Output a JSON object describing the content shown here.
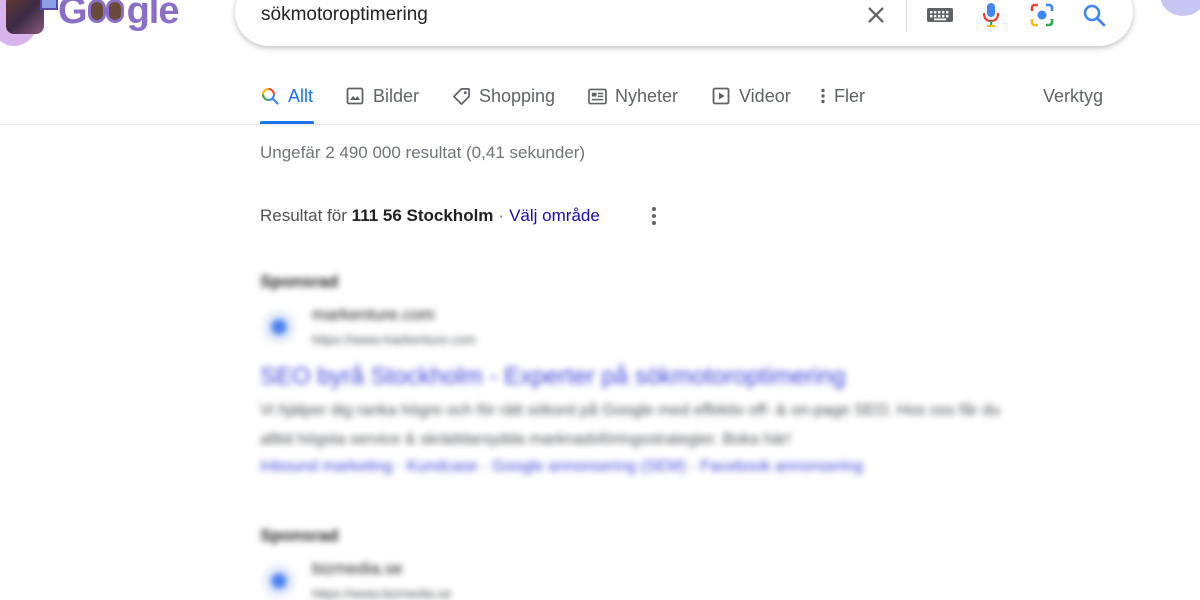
{
  "header": {
    "logo_text_g": "G",
    "logo_text_end": "gle",
    "query": "sökmotoroptimering"
  },
  "tabs": [
    {
      "label": "Allt",
      "icon": "search-icon",
      "active": true
    },
    {
      "label": "Bilder",
      "icon": "image-icon"
    },
    {
      "label": "Shopping",
      "icon": "tag-icon"
    },
    {
      "label": "Nyheter",
      "icon": "news-icon"
    },
    {
      "label": "Videor",
      "icon": "play-icon"
    },
    {
      "label": "Fler",
      "icon": "more-vert-icon"
    }
  ],
  "tools_label": "Verktyg",
  "stats": "Ungefär 2 490 000 resultat (0,41 sekunder)",
  "location": {
    "prefix": "Resultat för",
    "place": "111 56 Stockholm",
    "separator": "·",
    "change_link": "Välj område"
  },
  "ads": [
    {
      "sponsored": "Sponsrad",
      "site": "markenture.com",
      "url": "https://www.markenture.com",
      "title": "SEO byrå Stockholm - Experter på sökmotoroptimering",
      "description": "Vi hjälper dig ranka högre och för rätt sökord på Google med effektiv off- & on-page SEO. Hos oss får du alltid högsta service & skräddarsydda marknadsföringsstrategier. Boka här!",
      "sitelinks": "Inbound marketing · Kundcase · Google annonsering (SEM) · Facebook annonsering"
    },
    {
      "sponsored": "Sponsrad",
      "site": "bizmedia.se",
      "url": "https://www.bizmedia.se"
    }
  ],
  "colors": {
    "accent_blue": "#1a73e8",
    "link": "#1a0dab",
    "text_secondary": "#5f6368",
    "doodle_purple": "#8a6fc8"
  }
}
